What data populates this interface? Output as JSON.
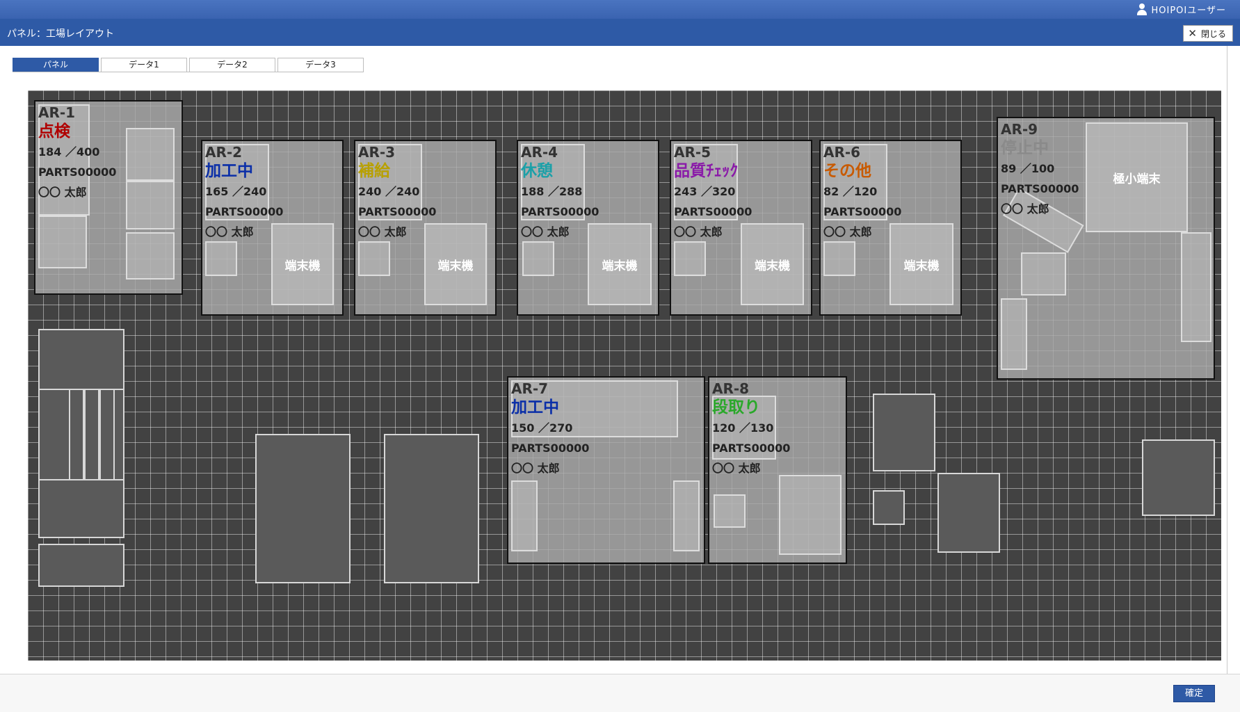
{
  "header": {
    "user_name": "HOIPOIユーザー",
    "title": "パネル：工場レイアウト",
    "close_label": "閉じる"
  },
  "tabs": [
    {
      "label": "パネル",
      "active": true
    },
    {
      "label": "データ1",
      "active": false
    },
    {
      "label": "データ2",
      "active": false
    },
    {
      "label": "データ3",
      "active": false
    }
  ],
  "areas": [
    {
      "id": "AR-1",
      "status": "点検",
      "status_color": "#b00000",
      "count": "184 ／400",
      "parts": "PARTS00000",
      "operator": "〇〇 太郎"
    },
    {
      "id": "AR-2",
      "status": "加工中",
      "status_color": "#0b2fa8",
      "count": "165 ／240",
      "parts": "PARTS00000",
      "operator": "〇〇 太郎",
      "terminal": "端末機"
    },
    {
      "id": "AR-3",
      "status": "補給",
      "status_color": "#b8a000",
      "count": "240 ／240",
      "parts": "PARTS00000",
      "operator": "〇〇 太郎",
      "terminal": "端末機"
    },
    {
      "id": "AR-4",
      "status": "休憩",
      "status_color": "#1ba0a8",
      "count": "188 ／288",
      "parts": "PARTS00000",
      "operator": "〇〇 太郎",
      "terminal": "端末機"
    },
    {
      "id": "AR-5",
      "status": "品質ﾁｪｯｸ",
      "status_color": "#8a1aa8",
      "count": "243 ／320",
      "parts": "PARTS00000",
      "operator": "〇〇 太郎",
      "terminal": "端末機"
    },
    {
      "id": "AR-6",
      "status": "その他",
      "status_color": "#c85a00",
      "count": "82 ／120",
      "parts": "PARTS00000",
      "operator": "〇〇 太郎",
      "terminal": "端末機"
    },
    {
      "id": "AR-7",
      "status": "加工中",
      "status_color": "#0b2fa8",
      "count": "150 ／270",
      "parts": "PARTS00000",
      "operator": "〇〇 太郎"
    },
    {
      "id": "AR-8",
      "status": "段取り",
      "status_color": "#2aa82a",
      "count": "120 ／130",
      "parts": "PARTS00000",
      "operator": "〇〇 太郎"
    },
    {
      "id": "AR-9",
      "status": "停止中",
      "status_color": "#8a8a8a",
      "count": "89 ／100",
      "parts": "PARTS00000",
      "operator": "〇〇 太郎",
      "terminal": "極小端末"
    }
  ],
  "footer": {
    "confirm_label": "確定"
  }
}
